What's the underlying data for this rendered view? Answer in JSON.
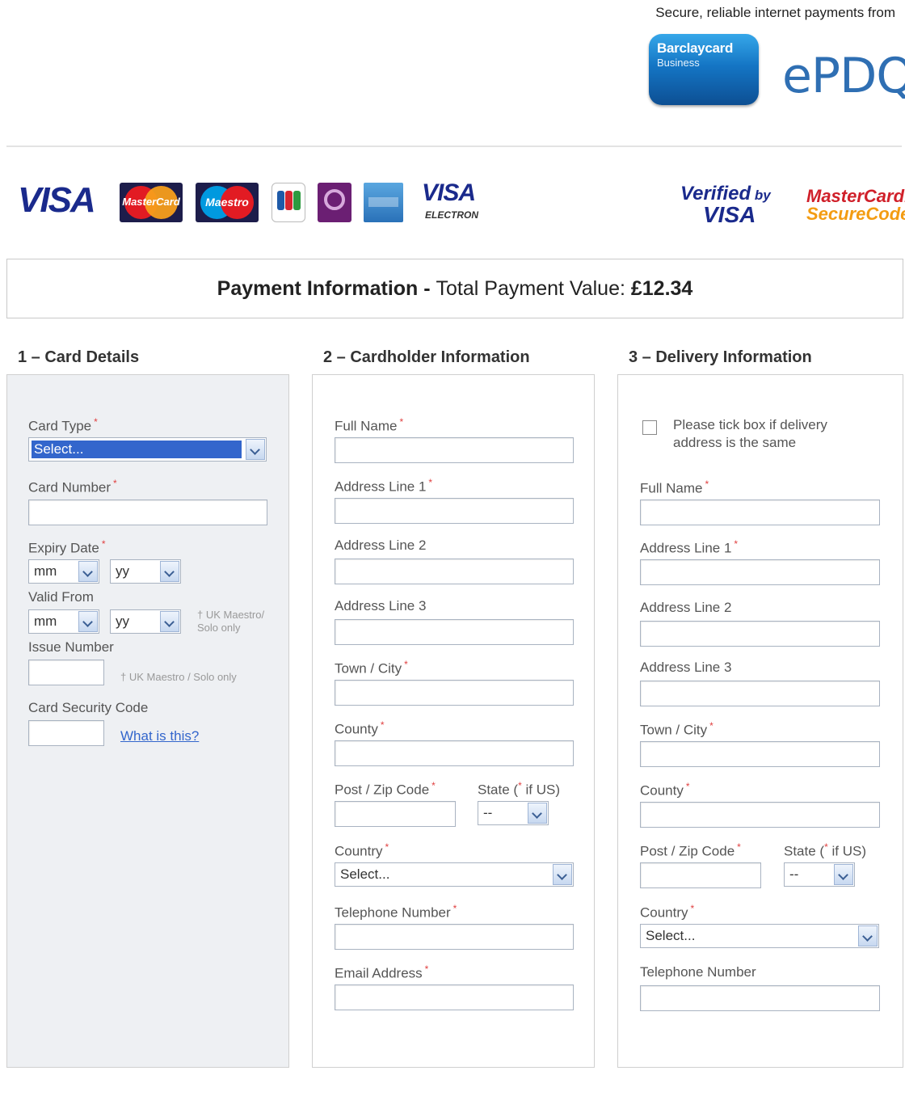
{
  "header": {
    "tagline": "Secure, reliable internet payments from",
    "barclaycard_line1": "Barclaycard",
    "barclaycard_line2": "Business",
    "brand": "ePDQ"
  },
  "card_logos": {
    "visa": "VISA",
    "mastercard": "MasterCard",
    "maestro": "Maestro",
    "visa_electron_1": "VISA",
    "visa_electron_2": "ELECTRON",
    "verified_by_1": "Verified",
    "verified_by_2": "by",
    "verified_by_3": "VISA",
    "securecode_1": "MasterCard.",
    "securecode_2": "SecureCode."
  },
  "payment": {
    "label": "Payment Information",
    "separator": " - ",
    "total_label": "Total Payment Value: ",
    "total_value": "£12.34"
  },
  "card_details": {
    "heading": "1 – Card Details",
    "card_type_label": "Card Type",
    "card_type_value": "Select...",
    "card_number_label": "Card Number",
    "expiry_label": "Expiry Date",
    "expiry_month": "mm",
    "expiry_year": "yy",
    "valid_from_label": "Valid From",
    "valid_month": "mm",
    "valid_year": "yy",
    "valid_note": "† UK Maestro/ Solo only",
    "issue_label": "Issue Number",
    "issue_note": "† UK Maestro / Solo only",
    "csc_label": "Card Security Code",
    "csc_link": "What is this?"
  },
  "cardholder": {
    "heading": "2 – Cardholder Information",
    "full_name": "Full Name",
    "address1": "Address Line 1",
    "address2": "Address Line 2",
    "address3": "Address Line 3",
    "town": "Town / City",
    "county": "County",
    "postcode": "Post / Zip Code",
    "state_label": "State (",
    "state_suffix": " if US)",
    "state_value": "--",
    "country": "Country",
    "country_value": "Select...",
    "telephone": "Telephone Number",
    "email": "Email Address"
  },
  "delivery": {
    "heading": "3 – Delivery Information",
    "same_address": "Please tick box if delivery address is the same",
    "full_name": "Full Name",
    "address1": "Address Line 1",
    "address2": "Address Line 2",
    "address3": "Address Line 3",
    "town": "Town / City",
    "county": "County",
    "postcode": "Post / Zip Code",
    "state_label": "State (",
    "state_suffix": " if US)",
    "state_value": "--",
    "country": "Country",
    "country_value": "Select...",
    "telephone": "Telephone Number"
  },
  "colors": {
    "required": "#e04040",
    "link": "#3366cc",
    "panel_grey": "#eef0f3"
  }
}
